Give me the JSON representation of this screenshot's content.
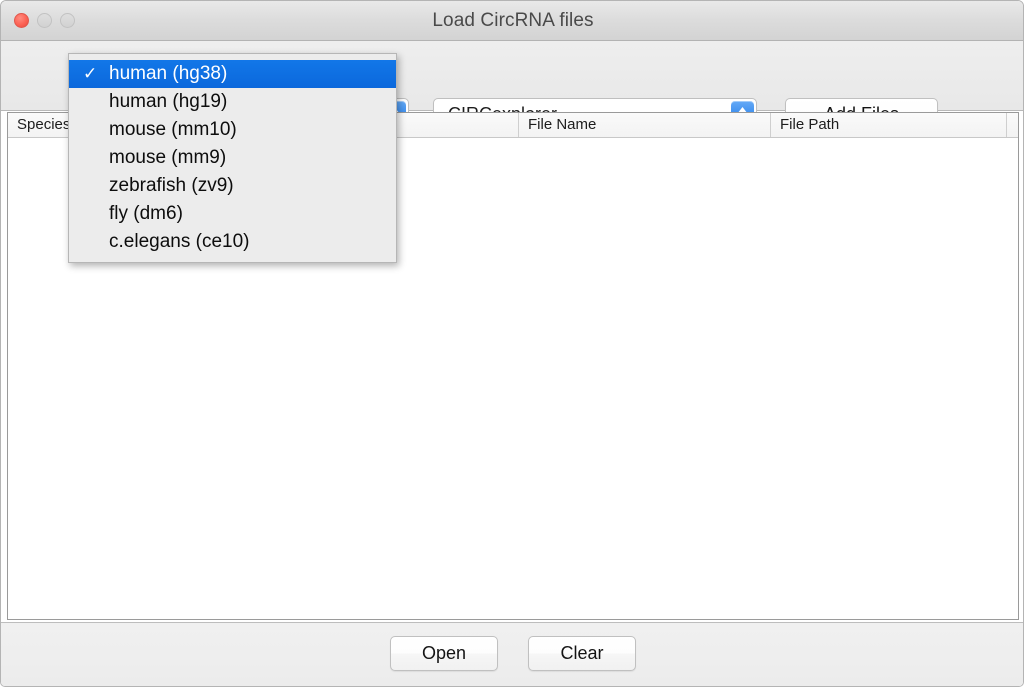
{
  "window": {
    "title": "Load CircRNA files",
    "traffic_lights": [
      {
        "name": "close",
        "color": "#fc6254",
        "enabled": true
      },
      {
        "name": "minimize",
        "color": "#d6d6d6",
        "enabled": false
      },
      {
        "name": "zoom",
        "color": "#d6d6d6",
        "enabled": false
      }
    ]
  },
  "toolbar": {
    "species_popup": {
      "selected": "human (hg38)",
      "options": [
        "human (hg38)",
        "human (hg19)",
        "mouse (mm10)",
        "mouse (mm9)",
        "zebrafish (zv9)",
        "fly (dm6)",
        "c.elegans (ce10)"
      ]
    },
    "tool_popup": {
      "selected": "CIRCexplorer"
    },
    "add_files_label": "Add Files"
  },
  "open_menu": {
    "visible": true,
    "selected_index": 0,
    "check_glyph": "✓",
    "highlight_color": "#0b68dc",
    "items": [
      {
        "label": "human (hg38)",
        "checked": true
      },
      {
        "label": "human (hg19)",
        "checked": false
      },
      {
        "label": "mouse (mm10)",
        "checked": false
      },
      {
        "label": "mouse (mm9)",
        "checked": false
      },
      {
        "label": "zebrafish (zv9)",
        "checked": false
      },
      {
        "label": "fly (dm6)",
        "checked": false
      },
      {
        "label": "c.elegans (ce10)",
        "checked": false
      }
    ]
  },
  "table": {
    "columns": [
      "Species",
      "File Name",
      "File Path"
    ],
    "rows": []
  },
  "footer": {
    "open_label": "Open",
    "clear_label": "Clear"
  }
}
